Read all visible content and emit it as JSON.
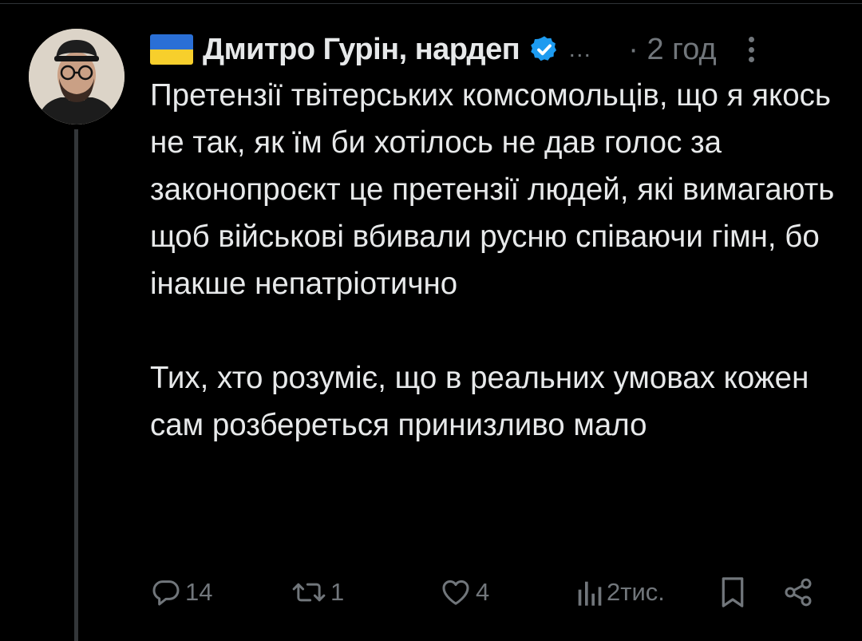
{
  "post": {
    "author": {
      "flag_icon": "ukraine-flag-icon",
      "name": "Дмитро Гурін, нардеп",
      "verified_icon": "verified-badge-icon",
      "verified_color": "#1d9bf0",
      "handle_truncated": "…"
    },
    "time": "· 2 год",
    "text": {
      "paragraph1": "Претензії твітерських комсомольців, що я якось не так, як їм би хотілось не дав голос за законопроєкт це претензії людей, які вимагають щоб військові вбивали русню співаючи гімн, бо інакше непатріотично",
      "paragraph2": "Тих, хто розуміє, що в реальних умовах кожен сам розбереться принизливо мало"
    },
    "actions": {
      "replies": "14",
      "reposts": "1",
      "likes": "4",
      "views": "2тис."
    }
  },
  "colors": {
    "background": "#000000",
    "text": "#e7e9ea",
    "muted": "#71767b",
    "thread_line": "#333639"
  }
}
